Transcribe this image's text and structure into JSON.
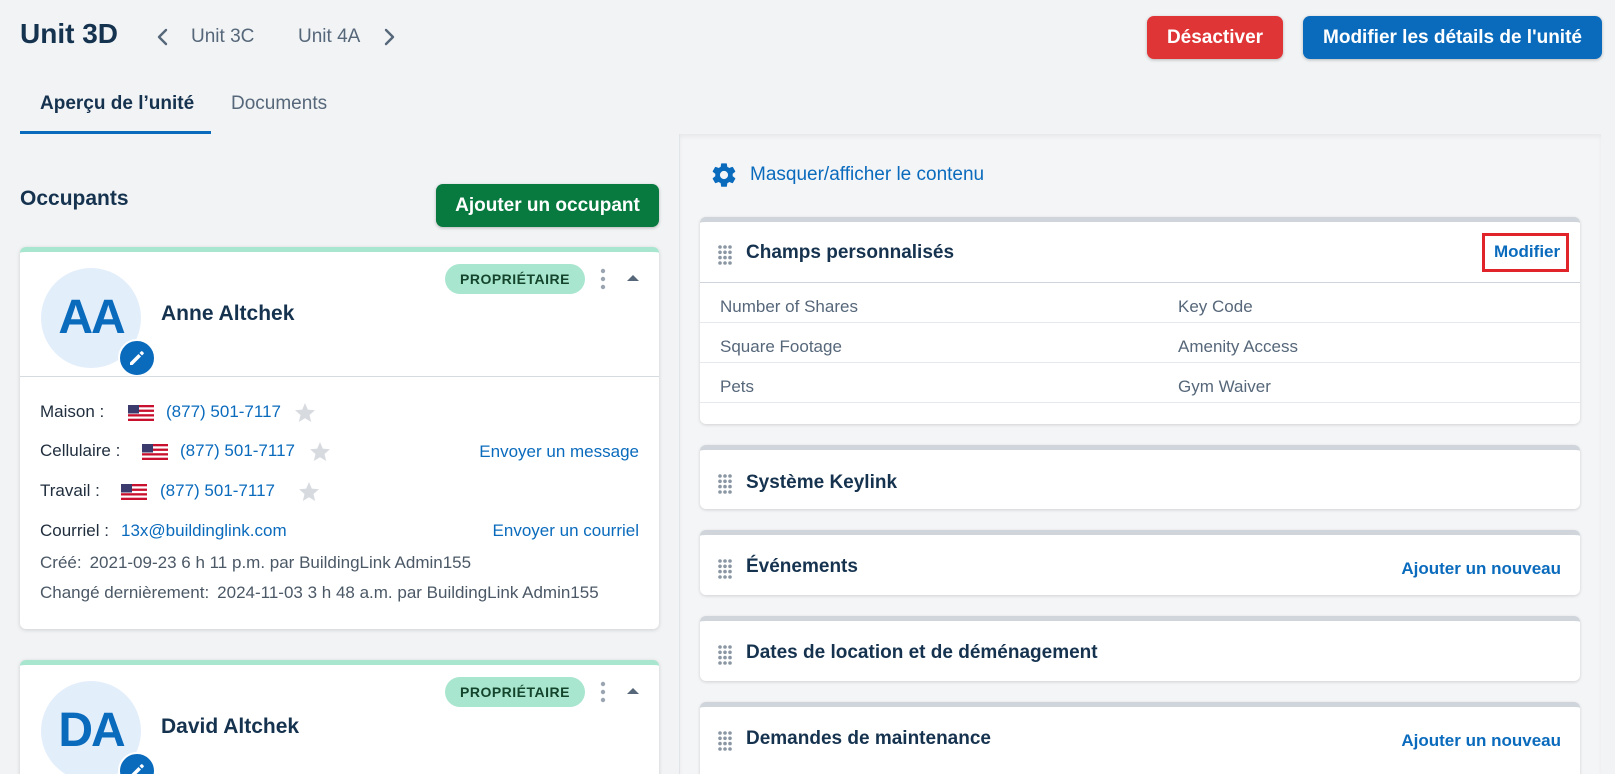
{
  "header": {
    "unit_title": "Unit 3D",
    "prev_unit": "Unit 3C",
    "next_unit": "Unit 4A",
    "deactivate_label": "Désactiver",
    "edit_unit_label": "Modifier les détails de l'unité"
  },
  "tabs": [
    {
      "label": "Aperçu de l’unité",
      "active": true
    },
    {
      "label": "Documents",
      "active": false
    }
  ],
  "occupants": {
    "title": "Occupants",
    "add_label": "Ajouter un occupant",
    "list": [
      {
        "initials": "AA",
        "name": "Anne Altchek",
        "badge": "PROPRIÉTAIRE",
        "home_label": "Maison :",
        "home_phone": "(877) 501-7117",
        "cell_label": "Cellulaire :",
        "cell_phone": "(877) 501-7117",
        "work_label": "Travail :",
        "work_phone": "(877) 501-7117",
        "send_message": "Envoyer un message",
        "email_label": "Courriel :",
        "email": "13x@buildinglink.com",
        "send_email": "Envoyer un courriel",
        "created_label": "Créé:",
        "created_value": "2021-09-23 6 h 11 p.m. par BuildingLink Admin155",
        "changed_label": "Changé dernièrement:",
        "changed_value": "2024-11-03 3 h 48 a.m. par BuildingLink Admin155"
      },
      {
        "initials": "DA",
        "name": "David Altchek",
        "badge": "PROPRIÉTAIRE"
      }
    ]
  },
  "right": {
    "hide_show_label": "Masquer/afficher le contenu",
    "custom_fields": {
      "title": "Champs personnalisés",
      "action": "Modifier",
      "fields": [
        [
          "Number of Shares",
          "Key Code"
        ],
        [
          "Square Footage",
          "Amenity Access"
        ],
        [
          "Pets",
          "Gym Waiver"
        ]
      ]
    },
    "sections": [
      {
        "title": "Système Keylink",
        "action": ""
      },
      {
        "title": "Événements",
        "action": "Ajouter un nouveau"
      },
      {
        "title": "Dates de location et de déménagement",
        "action": ""
      },
      {
        "title": "Demandes de maintenance",
        "action": "Ajouter un nouveau"
      }
    ]
  },
  "colors": {
    "primary": "#0a6bbd",
    "danger": "#e03537",
    "success": "#087a3f",
    "badge": "#a8e6cf",
    "highlight": "#e0242a"
  },
  "icons": [
    "chevron-left-icon",
    "chevron-right-icon",
    "pencil-icon",
    "kebab-icon",
    "caret-up-icon",
    "us-flag-icon",
    "star-icon",
    "gear-icon",
    "drag-handle-icon"
  ]
}
